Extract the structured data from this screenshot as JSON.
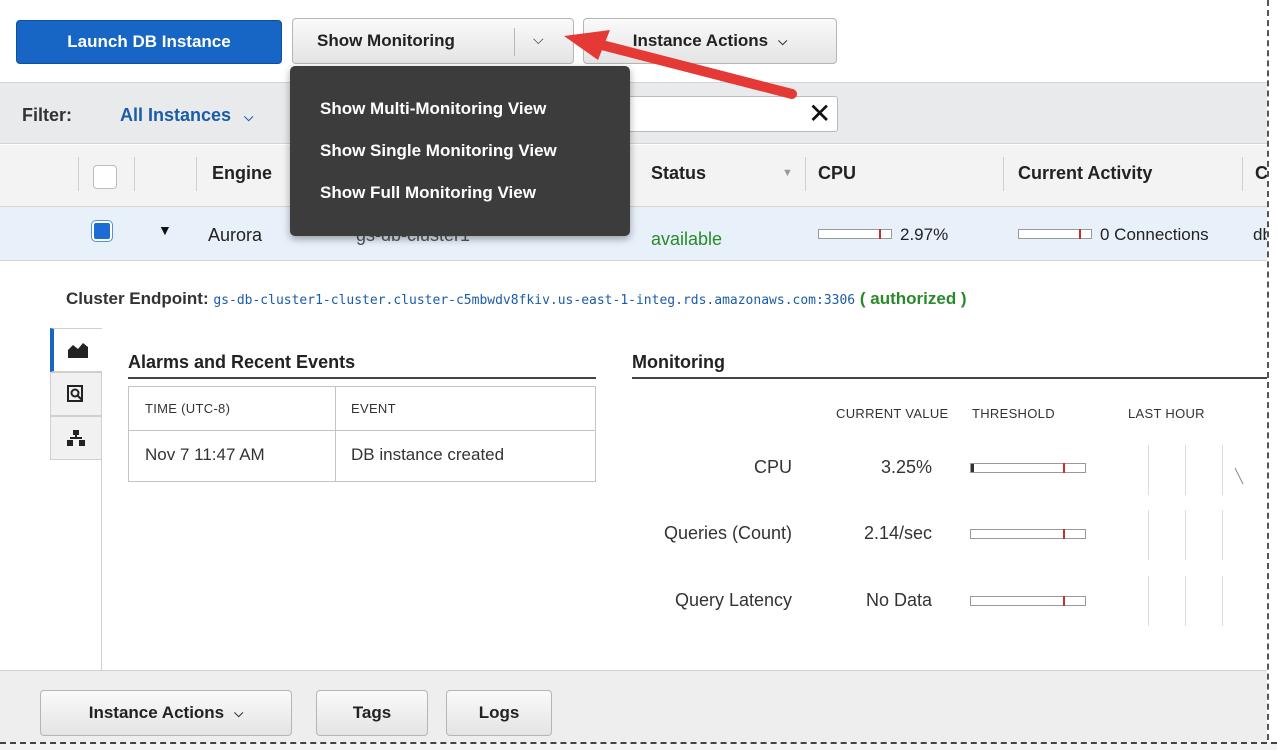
{
  "toolbar": {
    "launch_label": "Launch DB Instance",
    "show_monitoring_label": "Show Monitoring",
    "instance_actions_label": "Instance Actions"
  },
  "monitoring_menu": {
    "items": [
      "Show Multi-Monitoring View",
      "Show Single Monitoring View",
      "Show Full Monitoring View"
    ]
  },
  "filter": {
    "label": "Filter:",
    "selected": "All Instances",
    "search_value": ""
  },
  "table": {
    "columns": [
      "Engine",
      "Status",
      "CPU",
      "Current Activity",
      "C"
    ],
    "row": {
      "engine": "Aurora",
      "cluster": "gs-db-cluster1",
      "status": "available",
      "cpu": "2.97%",
      "cpu_fraction": 0.0297,
      "activity": "0 Connections",
      "extra": "db"
    }
  },
  "details": {
    "endpoint_label": "Cluster Endpoint:",
    "endpoint_value": "gs-db-cluster1-cluster.cluster-c5mbwdv8fkiv.us-east-1-integ.rds.amazonaws.com:3306",
    "authorized": "( authorized )",
    "alarms_title": "Alarms and Recent Events",
    "events_headers": {
      "time": "TIME (UTC-8)",
      "event": "EVENT"
    },
    "events": [
      {
        "time": "Nov 7 11:47 AM",
        "event": "DB instance created"
      }
    ],
    "monitoring_title": "Monitoring",
    "monitoring_headers": {
      "current_value": "CURRENT VALUE",
      "threshold": "THRESHOLD",
      "last_hour": "LAST HOUR"
    },
    "metrics": [
      {
        "name": "CPU",
        "value": "3.25%"
      },
      {
        "name": "Queries (Count)",
        "value": "2.14/sec"
      },
      {
        "name": "Query Latency",
        "value": "No Data"
      }
    ]
  },
  "bottom": {
    "instance_actions_label": "Instance Actions",
    "tags_label": "Tags",
    "logs_label": "Logs"
  },
  "colors": {
    "primary": "#1765c4",
    "menu_bg": "#3c3c3c",
    "available": "#2a8a2a",
    "annotation_arrow": "#e53935"
  }
}
